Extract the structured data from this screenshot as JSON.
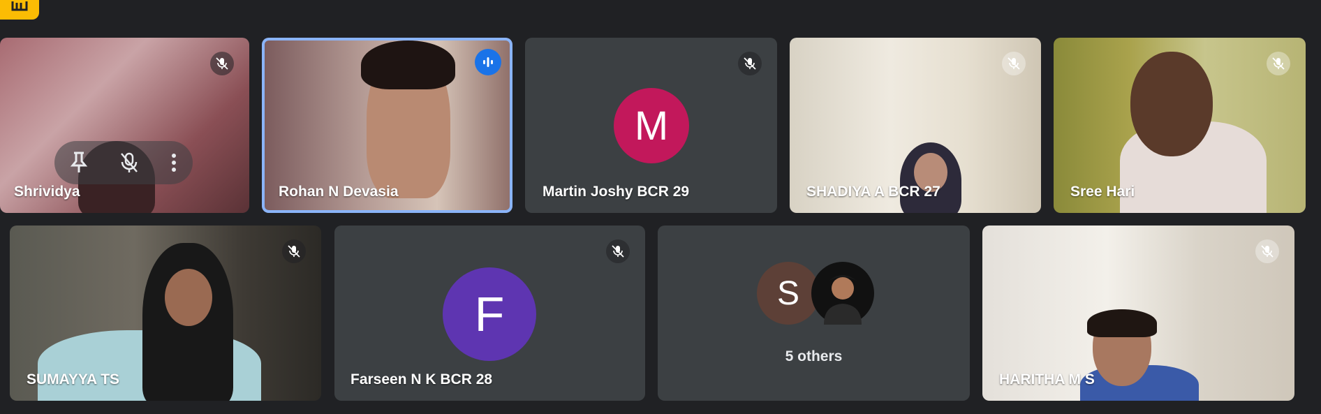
{
  "participants": [
    {
      "name": "Shrividya",
      "muted": true,
      "video": true
    },
    {
      "name": "Rohan N Devasia",
      "muted": false,
      "speaking": true,
      "video": true
    },
    {
      "name": "Martin Joshy BCR 29",
      "muted": true,
      "video": false,
      "avatar_letter": "M",
      "avatar_color": "#c2185b"
    },
    {
      "name": "SHADIYA A BCR 27",
      "muted": true,
      "video": true
    },
    {
      "name": "Sree Hari",
      "muted": true,
      "video": true
    },
    {
      "name": "SUMAYYA TS",
      "muted": true,
      "video": true
    },
    {
      "name": "Farseen N K BCR 28",
      "muted": true,
      "video": false,
      "avatar_letter": "F",
      "avatar_color": "#5e35b1"
    },
    {
      "name": "HARITHA M S",
      "muted": true,
      "video": true
    }
  ],
  "others_tile": {
    "label": "5 others",
    "avatar_letter": "S",
    "avatar_color": "#5d4037"
  },
  "hover_controls": [
    "pin-icon",
    "mic-off-icon",
    "more-vert-icon"
  ],
  "accent_color": "#8ab4f8",
  "corner_button_color": "#fbbc04"
}
